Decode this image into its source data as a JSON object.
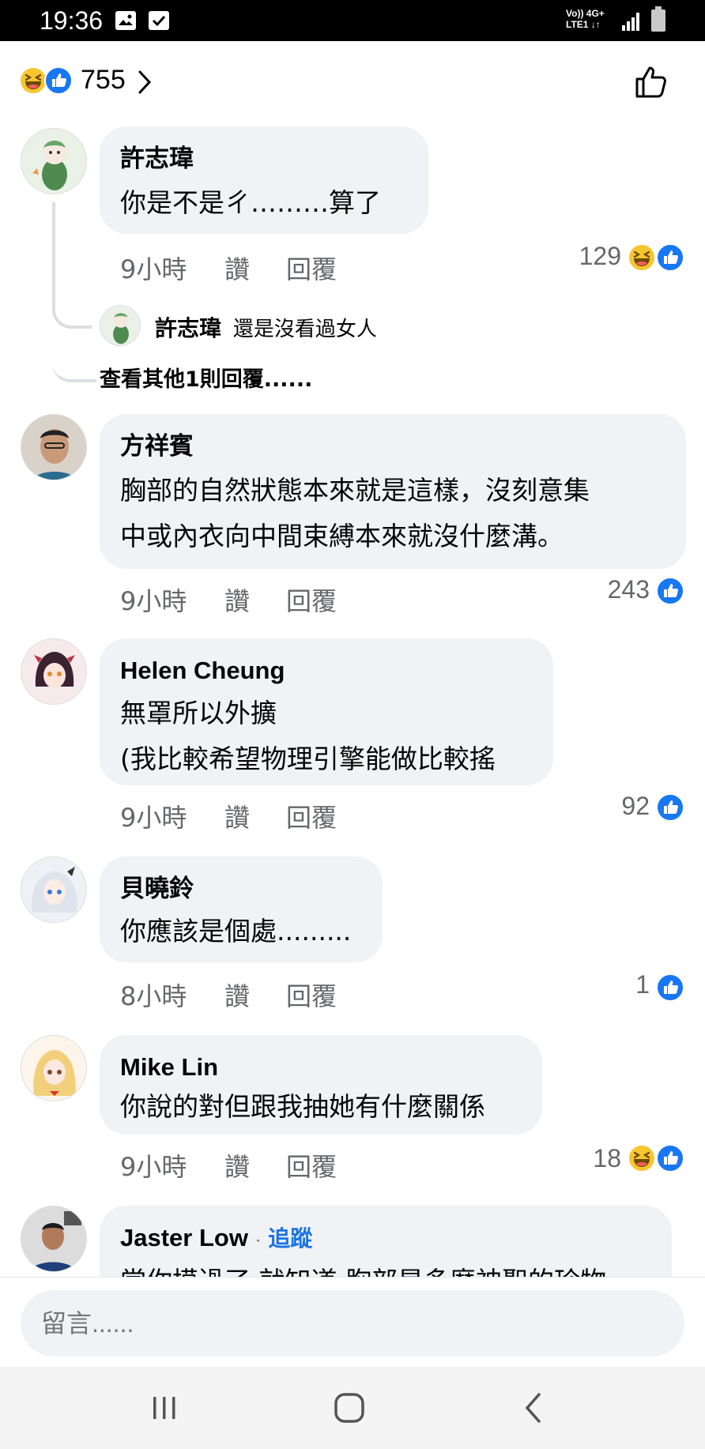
{
  "status_bar": {
    "time": "19:36",
    "network_line1": "Vo)) 4G+",
    "network_line2": "LTE1 ↓↑",
    "icons": [
      "gallery-icon",
      "check-box-icon",
      "signal-icon",
      "battery-icon"
    ]
  },
  "header": {
    "reaction_count": "755",
    "reaction_icons": [
      "haha-emoji-icon",
      "like-emoji-icon"
    ]
  },
  "comments": [
    {
      "name": "許志瑋",
      "text": "你是不是ㄔ………算了",
      "time": "9小時",
      "like": "讚",
      "reply": "回覆",
      "reactions": "129",
      "reaction_icons": [
        "haha",
        "like"
      ],
      "replies": {
        "name": "許志瑋",
        "text": "還是沒看過女人",
        "more": "查看其他1則回覆......"
      }
    },
    {
      "name": "方祥賓",
      "text": "胸部的自然狀態本來就是這樣，沒刻意集\n中或內衣向中間束縛本來就沒什麼溝。",
      "time": "9小時",
      "like": "讚",
      "reply": "回覆",
      "reactions": "243",
      "reaction_icons": [
        "like"
      ]
    },
    {
      "name": "Helen Cheung",
      "text": "無罩所以外擴\n(我比較希望物理引擎能做比較搖",
      "time": "9小時",
      "like": "讚",
      "reply": "回覆",
      "reactions": "92",
      "reaction_icons": [
        "like"
      ]
    },
    {
      "name": "貝曉鈴",
      "text": "你應該是個處.........",
      "time": "8小時",
      "like": "讚",
      "reply": "回覆",
      "reactions": "1",
      "reaction_icons": [
        "like"
      ]
    },
    {
      "name": "Mike Lin",
      "text": "你說的對但跟我抽她有什麼關係",
      "time": "9小時",
      "like": "讚",
      "reply": "回覆",
      "reactions": "18",
      "reaction_icons": [
        "haha",
        "like"
      ]
    },
    {
      "name": "Jaster Low",
      "follow_sep": "·",
      "follow": "追蹤",
      "text": "當你摸過了 就知道 胸部是多麼神聖的珍物"
    }
  ],
  "composer": {
    "placeholder": "留言......"
  },
  "colors": {
    "accent_blue": "#1b74e4",
    "bubble_gray": "#f0f2f5",
    "meta_gray": "#65676b",
    "haha_yellow": "#f7c530"
  },
  "nav_bar": {
    "icons": [
      "recent-apps-icon",
      "home-icon",
      "back-icon"
    ]
  }
}
